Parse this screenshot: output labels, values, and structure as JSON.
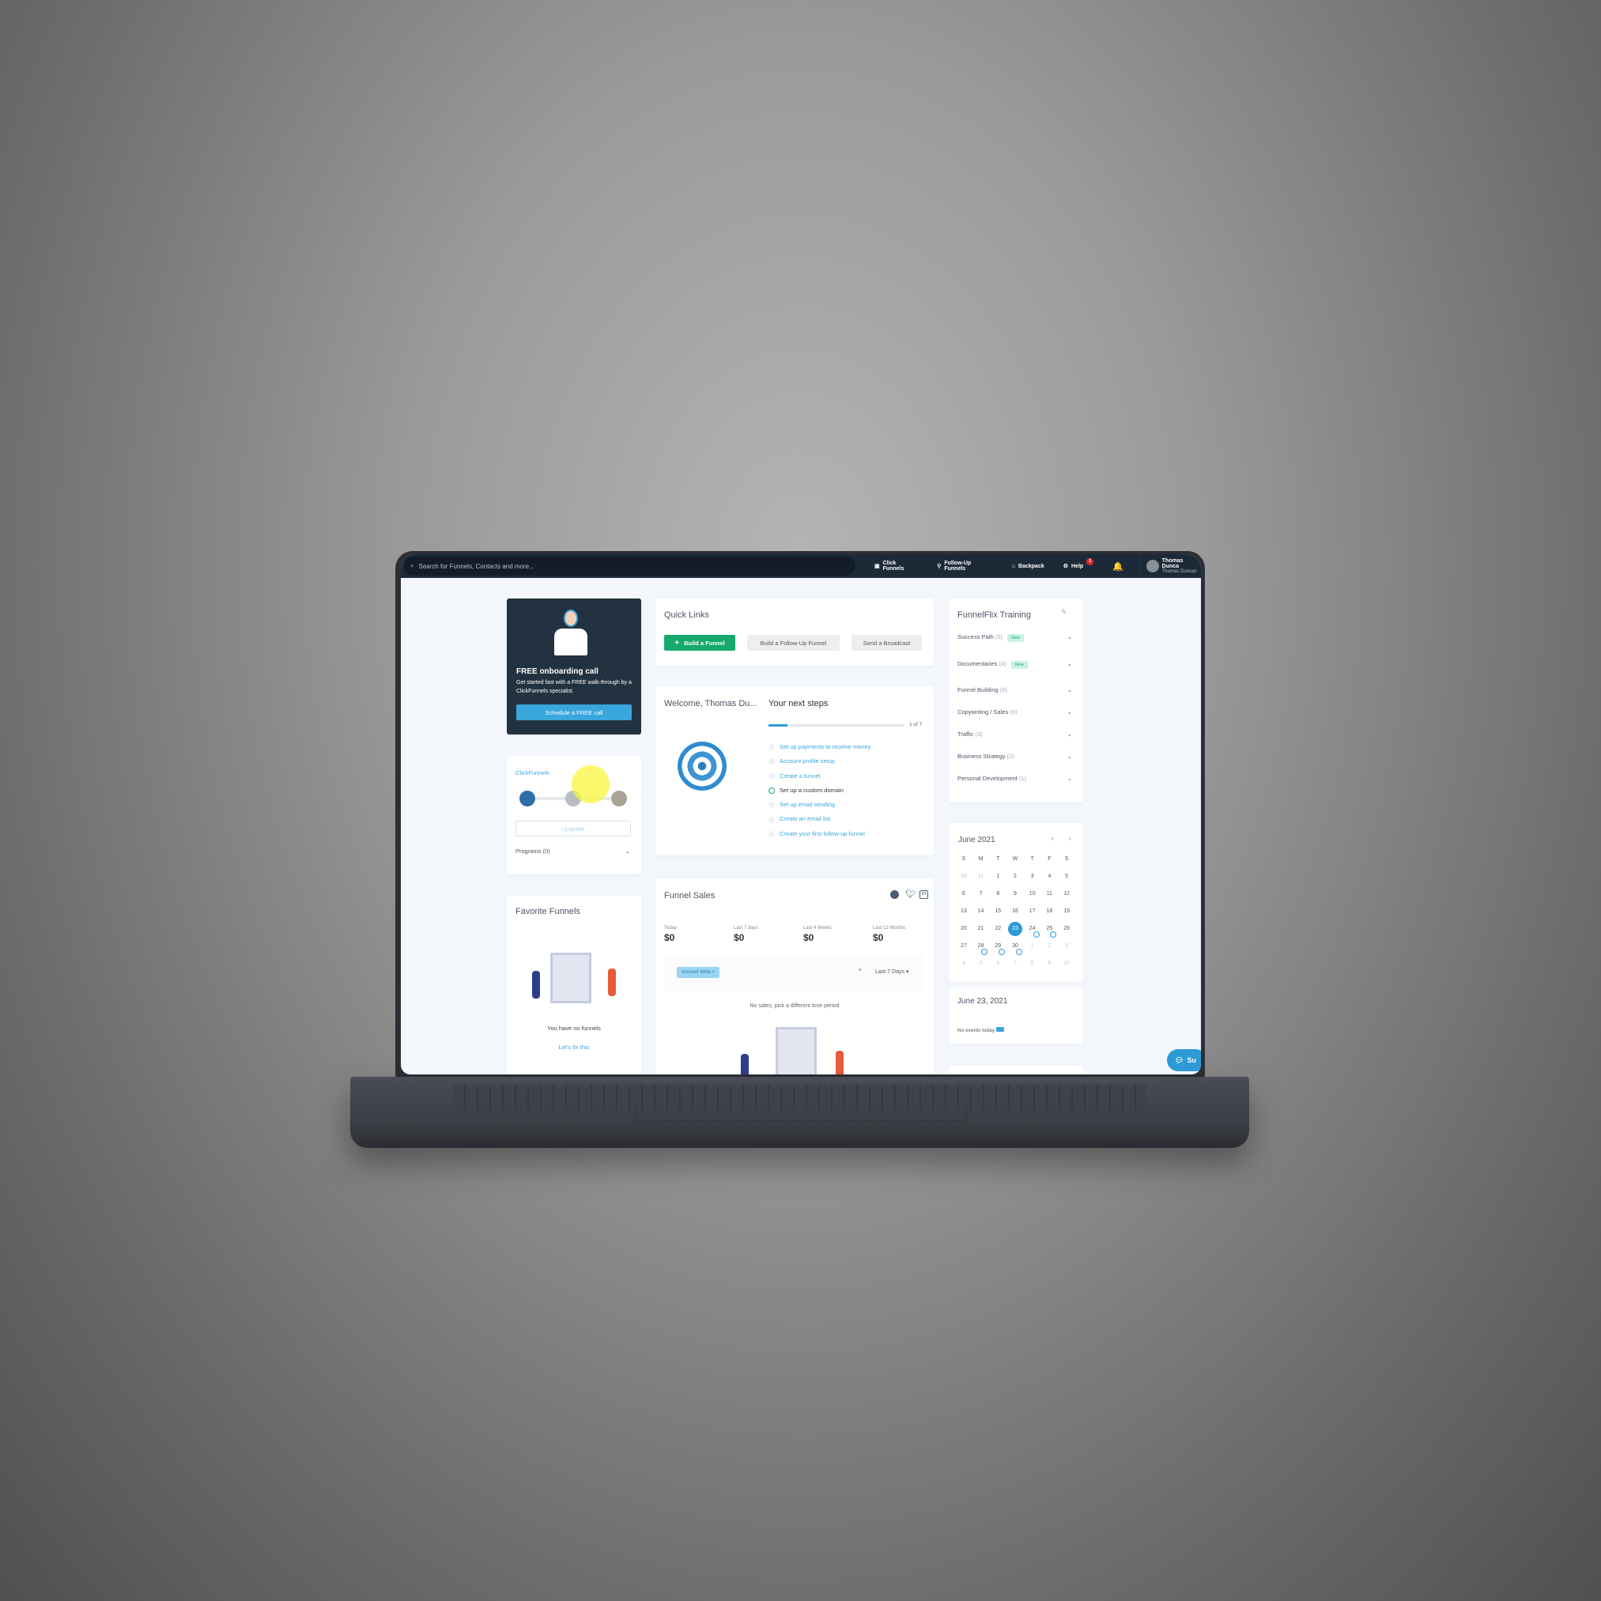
{
  "topbar": {
    "search_placeholder": "Search for Funnels, Contacts and more...",
    "nav": [
      "Click Funnels",
      "Follow-Up Funnels",
      "Backpack",
      "Help"
    ],
    "help_badge": "1",
    "user_name": "Thomas Dunca",
    "user_sub": "Thomas Duncan"
  },
  "onboarding": {
    "title": "FREE onboarding call",
    "text": "Get started fast with a FREE walk-through by a ClickFunnels specialist.",
    "button": "Schedule a FREE call"
  },
  "plan": {
    "label": "ClickFunnels",
    "upgrade": "Upgrade",
    "programs": "Programs (0)"
  },
  "favorites": {
    "title": "Favorite Funnels",
    "empty": "You have no funnels",
    "fix": "Let's fix this"
  },
  "quick_links": {
    "title": "Quick Links",
    "buttons": [
      "Build a Funnel",
      "Build a Follow-Up Funnel",
      "Send a Broadcast"
    ]
  },
  "welcome": {
    "title": "Welcome, Thomas Du...",
    "steps_title": "Your next steps",
    "progress_label": "1 of 7",
    "progress": 0.14,
    "steps": [
      {
        "label": "Set up payments to receive money",
        "done": false
      },
      {
        "label": "Account profile setup",
        "done": false
      },
      {
        "label": "Create a funnel",
        "done": false
      },
      {
        "label": "Set up a custom domain",
        "done": true
      },
      {
        "label": "Set up email sending",
        "done": false
      },
      {
        "label": "Create an email list",
        "done": false
      },
      {
        "label": "Create your first follow-up funnel",
        "done": false
      }
    ]
  },
  "sales": {
    "title": "Funnel Sales",
    "stats": [
      {
        "label": "Today",
        "value": "$0"
      },
      {
        "label": "Last 7 days",
        "value": "$0"
      },
      {
        "label": "Last 4 Weeks",
        "value": "$0"
      },
      {
        "label": "Last 12 Months",
        "value": "$0"
      }
    ],
    "filter_tag": "Account Wide",
    "period": "Last 7 Days",
    "empty": "No sales, pick a different time period"
  },
  "training": {
    "title": "FunnelFlix Training",
    "new_label": "New",
    "items": [
      {
        "name": "Success Path",
        "count": "(5)",
        "new": true
      },
      {
        "name": "Documentaries",
        "count": "(4)",
        "new": true
      },
      {
        "name": "Funnel Building",
        "count": "(6)"
      },
      {
        "name": "Copywriting / Sales",
        "count": "(9)"
      },
      {
        "name": "Traffic",
        "count": "(3)"
      },
      {
        "name": "Business Strategy",
        "count": "(2)"
      },
      {
        "name": "Personal Development",
        "count": "(1)"
      }
    ]
  },
  "calendar": {
    "month": "June 2021",
    "weekdays": [
      "S",
      "M",
      "T",
      "W",
      "T",
      "F",
      "S"
    ],
    "days": [
      "30",
      "31",
      "1",
      "2",
      "3",
      "4",
      "5",
      "6",
      "7",
      "8",
      "9",
      "10",
      "11",
      "12",
      "13",
      "14",
      "15",
      "16",
      "17",
      "18",
      "19",
      "20",
      "21",
      "22",
      "23",
      "24",
      "25",
      "26",
      "27",
      "28",
      "29",
      "30",
      "1",
      "2",
      "3",
      "4",
      "5",
      "6",
      "7",
      "8",
      "9",
      "10"
    ],
    "selected": "23",
    "event_days": [
      "24",
      "25",
      "28",
      "29",
      "30"
    ],
    "date_title": "June 23, 2021",
    "no_events": "No events today"
  },
  "chat": {
    "label": "Su"
  },
  "colors": {
    "accent": "#39a6dc",
    "green": "#16a96b",
    "topbar": "#1c2a38"
  }
}
